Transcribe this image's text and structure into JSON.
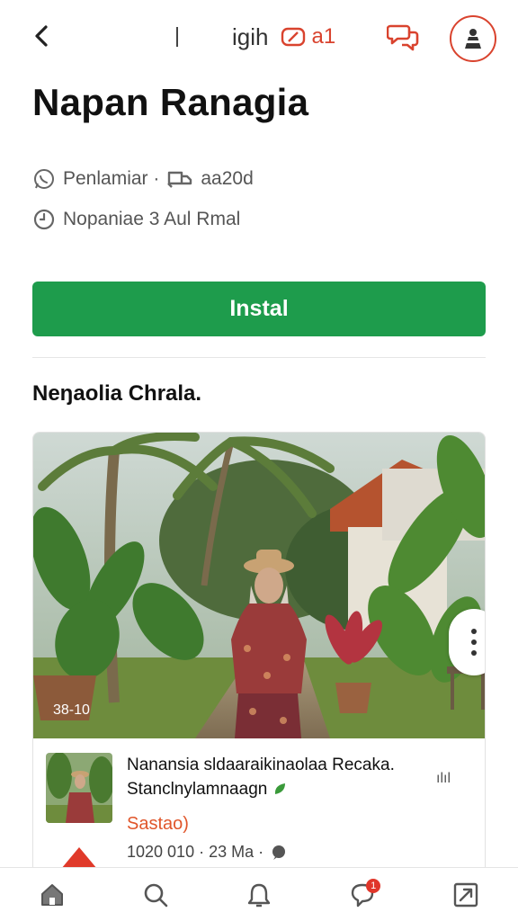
{
  "topbar": {
    "title_fragment": "igih",
    "badge_count": "a1",
    "accent": "#d9432e"
  },
  "app": {
    "title": "Napan Ranagia",
    "meta1_author": "Penlamiar ·",
    "meta1_value": "aa20d",
    "meta2_text": "Nopaniae 3 Aul Rmal"
  },
  "install": {
    "label": "Instal",
    "color": "#1e9c4c"
  },
  "section": {
    "title": "Neŋaolia Chrala."
  },
  "photo": {
    "count": "38-10"
  },
  "listing": {
    "title": "Nanansia sldaaraikinaolaa Recaka. Stanclnylamnaagn",
    "signal": "ılıl",
    "price": "Sastao)",
    "meta": "1020 010 · 23 Ma ·"
  },
  "icons": {
    "back": "chevron-left-icon",
    "chat": "chat-icon",
    "avatar": "user-avatar-icon",
    "home": "home-icon",
    "search": "search-icon",
    "notifications": "bell-icon",
    "messages": "message-icon",
    "expand": "expand-icon"
  },
  "bottom_nav": {
    "messages_badge": "1"
  }
}
